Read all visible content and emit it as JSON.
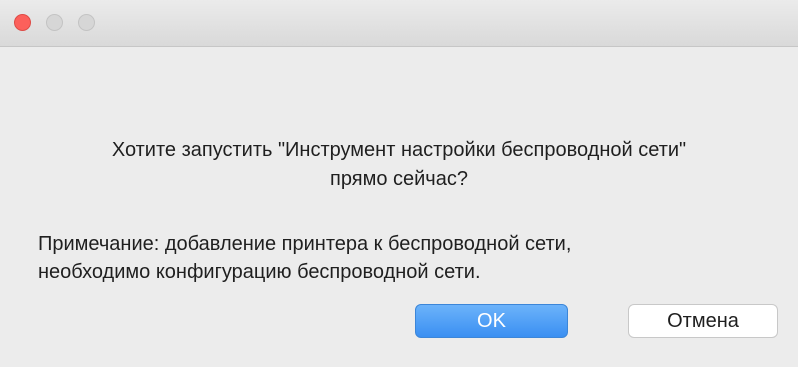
{
  "dialog": {
    "window_controls": {
      "close_color": "#fc605b",
      "inactive_color": "#d6d6d6"
    },
    "question": {
      "line1": "Хотите запустить \"Инструмент настройки беспроводной сети\"",
      "line2": "прямо сейчас?"
    },
    "note": {
      "line1": "Примечание: добавление принтера к беспроводной сети,",
      "line2": "необходимо конфигурацию беспроводной сети."
    },
    "buttons": {
      "ok_label": "OK",
      "cancel_label": "Отмена"
    },
    "colors": {
      "default_button": "#3a8ff2"
    }
  }
}
